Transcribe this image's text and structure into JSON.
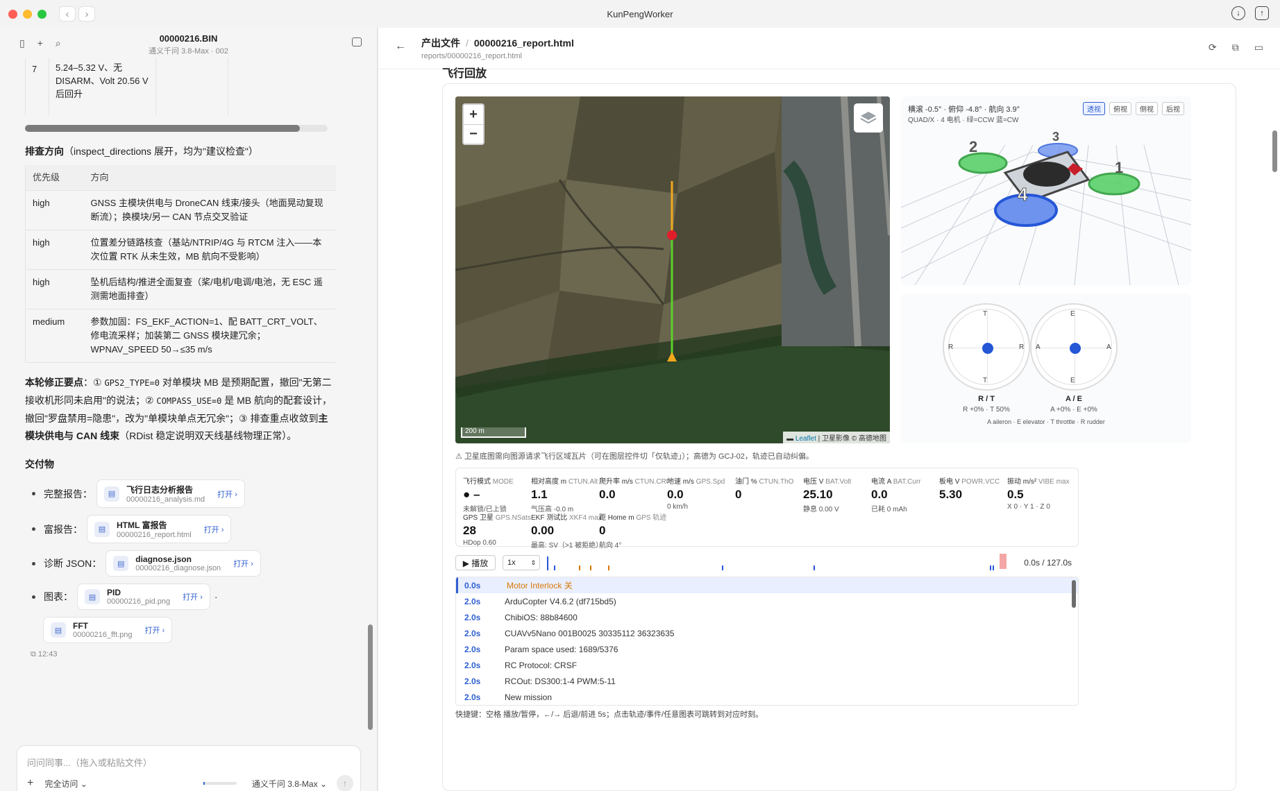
{
  "app_title": "KunPengWorker",
  "left": {
    "file_name": "00000216.BIN",
    "file_sub": "通义千问 3.8-Max · 002",
    "table_fragment": {
      "rownum": "7",
      "text": "5.24–5.32 V、无 DISARM、Volt 20.56 V 后回升"
    },
    "inspect_title": "排查方向",
    "inspect_title_sub": "（inspect_directions 展开，均为\"建议检查\"）",
    "inspect_headers": [
      "优先级",
      "方向"
    ],
    "inspect_rows": [
      {
        "priority": "high",
        "text": "GNSS 主模块供电与 DroneCAN 线束/接头（地面晃动复现断流）；换模块/另一 CAN 节点交叉验证"
      },
      {
        "priority": "high",
        "text": "位置差分链路核查（基站/NTRIP/4G 与 RTCM 注入——本次位置 RTK 从未生效，MB 航向不受影响）"
      },
      {
        "priority": "high",
        "text": "坠机后结构/推进全面复查（桨/电机/电调/电池，无 ESC 遥测需地面排查）"
      },
      {
        "priority": "medium",
        "text": "参数加固：FS_EKF_ACTION=1、配 BATT_CRT_VOLT、修电流采样；加装第二 GNSS 模块建冗余；WPNAV_SPEED 50→≤35 m/s"
      }
    ],
    "summary": {
      "label": "本轮修正要点",
      "p1": "：① ",
      "code1": "GPS2_TYPE=0",
      "p2": " 对单模块 MB 是预期配置，撤回\"无第二接收机形同未启用\"的说法；② ",
      "code2": "COMPASS_USE=0",
      "p3": " 是 MB 航向的配套设计，撤回\"罗盘禁用=隐患\"，改为\"单模块单点无冗余\"；③ 排查重点收敛到",
      "bold2": "主模块供电与 CAN 线束",
      "p4": "（RDist 稳定说明双天线基线物理正常）。"
    },
    "deliverables_title": "交付物",
    "deliverables": [
      {
        "label": "完整报告：",
        "name": "飞行日志分析报告",
        "file": "00000216_analysis.md",
        "open": "打开 ›"
      },
      {
        "label": "富报告：",
        "name": "HTML 富报告",
        "file": "00000216_report.html",
        "open": "打开 ›"
      },
      {
        "label": "诊断 JSON：",
        "name": "diagnose.json",
        "file": "00000216_diagnose.json",
        "open": "打开 ›"
      },
      {
        "label": "图表：",
        "name": "PID",
        "file": "00000216_pid.png",
        "open": "打开 ›"
      }
    ],
    "deliverable_fft": {
      "name": "FFT",
      "file": "00000216_fft.png",
      "open": "打开 ›"
    },
    "timestamp": "12:43",
    "composer_placeholder": "问问同事...（拖入或粘贴文件）",
    "access_label": "完全访问",
    "model_label": "通义千问 3.8-Max"
  },
  "right": {
    "crumb_root": "产出文件",
    "crumb_file": "00000216_report.html",
    "path": "reports/00000216_report.html",
    "section_title": "飞行回放",
    "map": {
      "scale": "200 m",
      "attrib_leaflet": "Leaflet",
      "attrib_rest": " | 卫星影像 © 高德地图"
    },
    "map_note": "⚠ 卫星底图需向图源请求飞行区域瓦片（可在图层控件切「仅轨迹」）；高德为 GCJ-02，轨迹已自动纠偏。",
    "attitude": {
      "line1": "横滚 -0.5° · 俯仰 -4.8° · 航向 3.9°",
      "line2": "QUAD/X · 4 电机 · 绿=CCW 蓝=CW",
      "views": [
        "透视",
        "俯视",
        "侧视",
        "后视"
      ]
    },
    "sticks": {
      "left": {
        "top": "T",
        "bottom": "T",
        "l": "R",
        "r": "R",
        "label": "R / T",
        "sub": "R +0% · T 50%"
      },
      "right": {
        "top": "E",
        "bottom": "E",
        "l": "A",
        "r": "A",
        "label": "A / E",
        "sub": "A +0% · E +0%"
      },
      "legend": "A aileron · E elevator · T throttle · R rudder"
    },
    "telemetry": [
      {
        "label": "飞行模式",
        "key": "MODE",
        "value": "● –",
        "sub": "未解锁/已上锁"
      },
      {
        "label": "相对高度 m",
        "key": "CTUN.Alt",
        "value": "1.1",
        "sub": "气压高 -0.0 m"
      },
      {
        "label": "爬升率 m/s",
        "key": "CTUN.CRt",
        "value": "0.0",
        "sub": ""
      },
      {
        "label": "地速 m/s",
        "key": "GPS.Spd",
        "value": "0.0",
        "sub": "0 km/h"
      },
      {
        "label": "油门 %",
        "key": "CTUN.ThO",
        "value": "0",
        "sub": ""
      },
      {
        "label": "电压 V",
        "key": "BAT.Volt",
        "value": "25.10",
        "sub": "静息 0.00 V"
      },
      {
        "label": "电流 A",
        "key": "BAT.Curr",
        "value": "0.0",
        "sub": "已耗 0 mAh"
      },
      {
        "label": "板电 V",
        "key": "POWR.VCC",
        "value": "5.30",
        "sub": ""
      },
      {
        "label": "振动 m/s²",
        "key": "VIBE max",
        "value": "0.5",
        "sub": "X 0 · Y 1 · Z 0"
      },
      {
        "label": "GPS 卫星",
        "key": "GPS.NSats",
        "value": "28",
        "sub": "HDop 0.60"
      },
      {
        "label": "EKF 测试比",
        "key": "XKF4 max",
        "value": "0.00",
        "sub": "最高: SV（>1 被拒绝）"
      },
      {
        "label": "距 Home m",
        "key": "GPS 轨迹",
        "value": "0",
        "sub": "航向 4°"
      }
    ],
    "playback": {
      "play": "▶ 播放",
      "speed": "1x",
      "time": "0.0s / 127.0s",
      "progress_fraction": 0.0
    },
    "events": [
      {
        "t": "0.0s",
        "msg": "Motor Interlock 关"
      },
      {
        "t": "2.0s",
        "msg": "ArduCopter V4.6.2 (df715bd5)"
      },
      {
        "t": "2.0s",
        "msg": "ChibiOS: 88b84600"
      },
      {
        "t": "2.0s",
        "msg": "CUAVv5Nano 001B0025 30335112 36323635"
      },
      {
        "t": "2.0s",
        "msg": "Param space used: 1689/5376"
      },
      {
        "t": "2.0s",
        "msg": "RC Protocol: CRSF"
      },
      {
        "t": "2.0s",
        "msg": "RCOut: DS300:1-4 PWM:5-11"
      },
      {
        "t": "2.0s",
        "msg": "New mission"
      }
    ],
    "shortcut": "快捷键：空格 播放/暂停，←/→ 后退/前进 5s；点击轨迹/事件/任意图表可跳转到对应时刻。"
  },
  "colors": {
    "accent": "#2f5fd0",
    "highlight_event": "#d97706",
    "track_orange": "#f2a81d",
    "track_green": "#5bd12a",
    "marker_red": "#e11d2a"
  }
}
